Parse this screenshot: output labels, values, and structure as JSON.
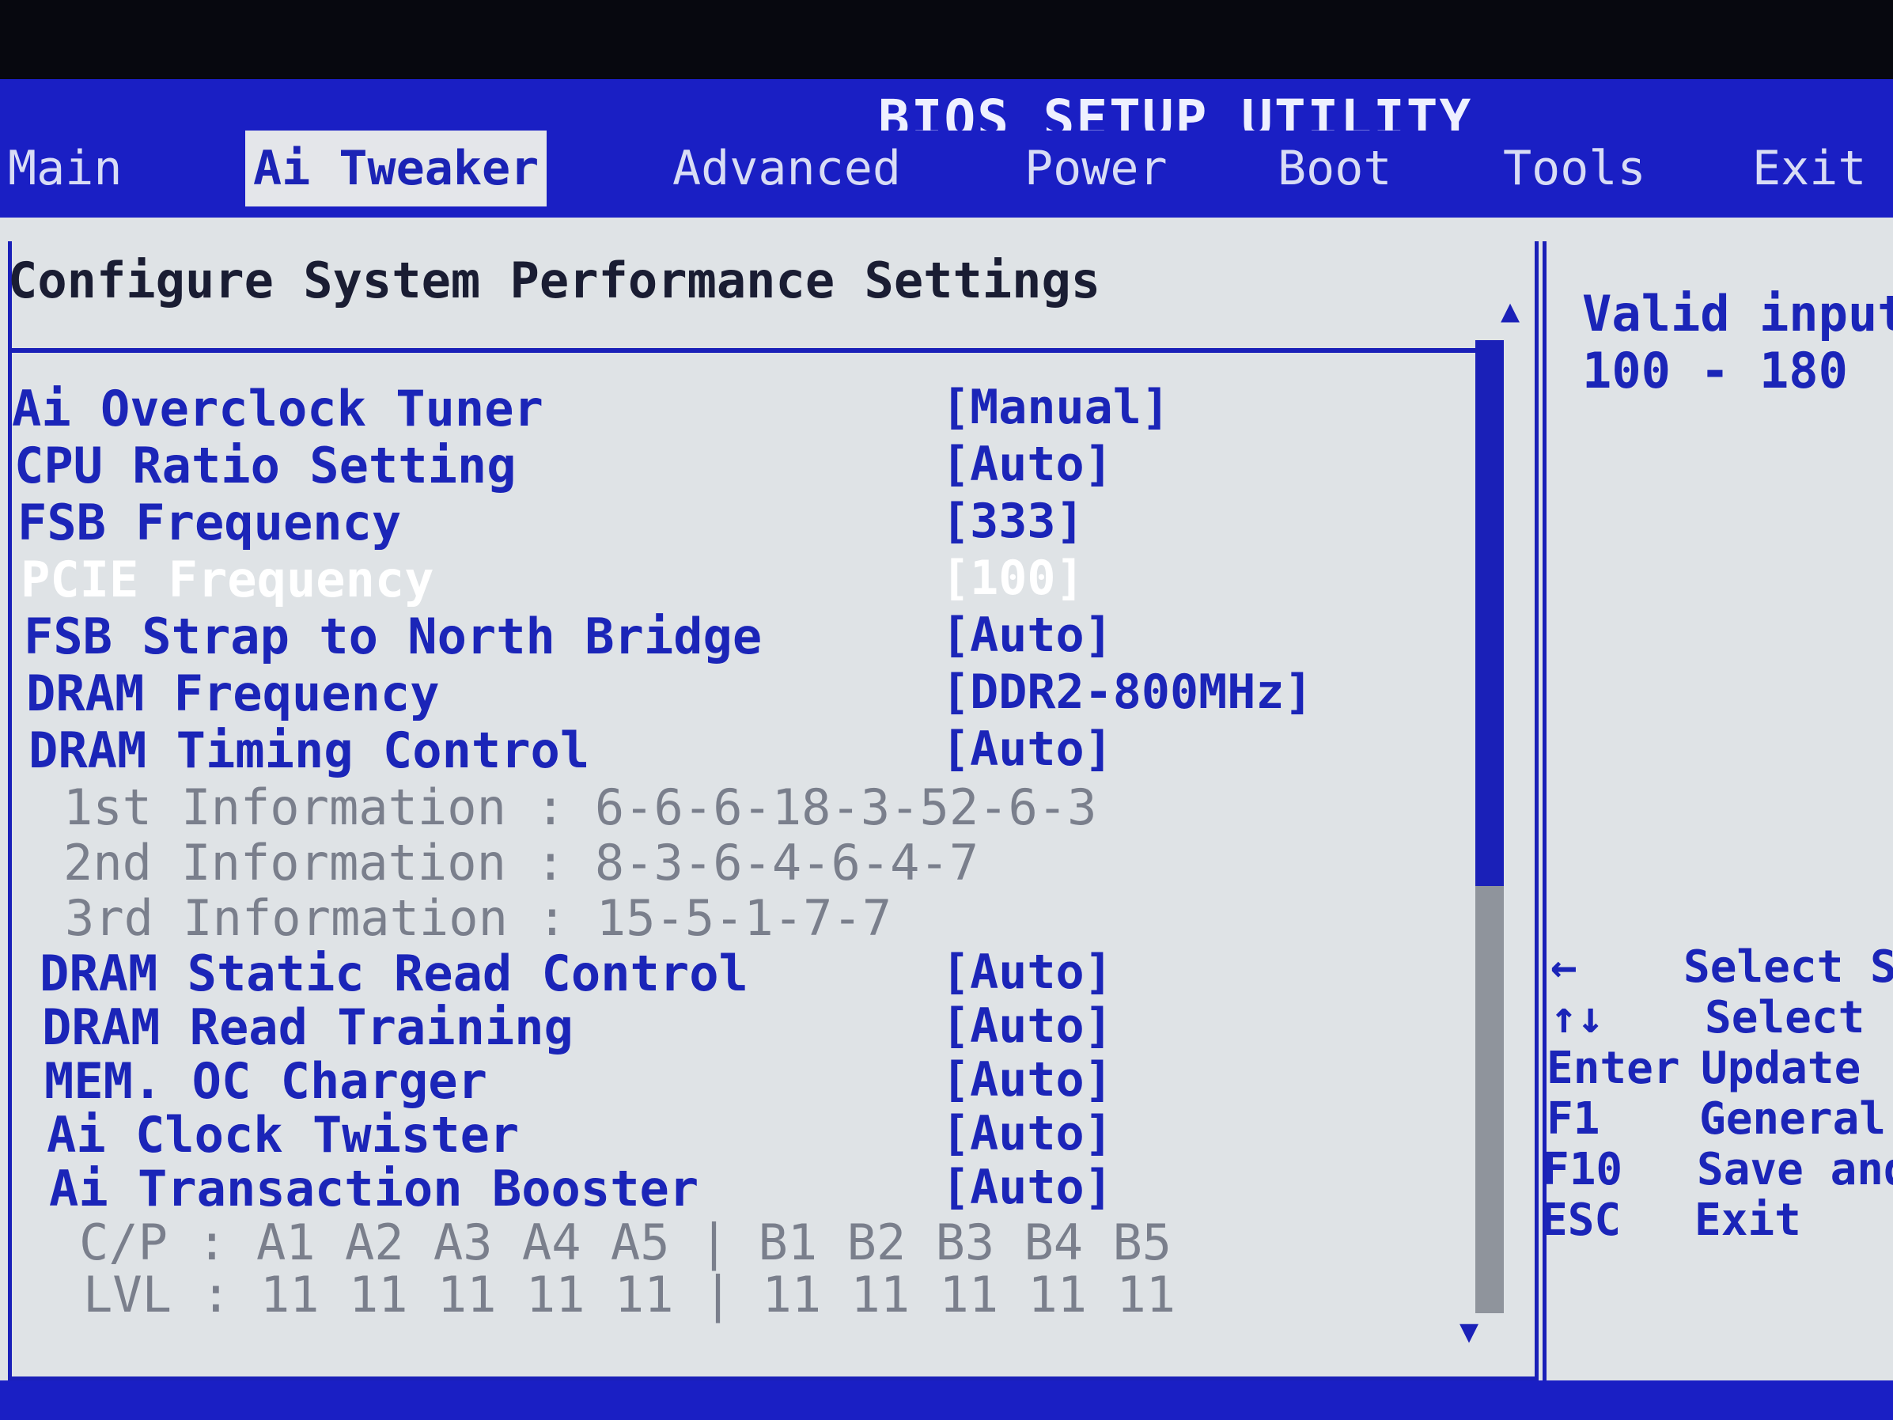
{
  "title": "BIOS SETUP UTILITY",
  "tabs": [
    {
      "label": "Main"
    },
    {
      "label": "Ai Tweaker"
    },
    {
      "label": "Advanced"
    },
    {
      "label": "Power"
    },
    {
      "label": "Boot"
    },
    {
      "label": "Tools"
    },
    {
      "label": "Exit"
    }
  ],
  "section_title": "Configure System Performance Settings",
  "settings": [
    {
      "label": "Ai Overclock Tuner",
      "value": "[Manual]"
    },
    {
      "label": "CPU Ratio Setting",
      "value": "[Auto]"
    },
    {
      "label": "FSB Frequency",
      "value": "[333]"
    },
    {
      "label": "PCIE Frequency",
      "value": "[100]"
    },
    {
      "label": "FSB Strap to North Bridge",
      "value": "[Auto]"
    },
    {
      "label": "DRAM Frequency",
      "value": "[DDR2-800MHz]"
    },
    {
      "label": "DRAM Timing Control",
      "value": "[Auto]"
    }
  ],
  "timing_info": [
    {
      "text": "1st Information : 6-6-6-18-3-52-6-3"
    },
    {
      "text": "2nd Information : 8-3-6-4-6-4-7"
    },
    {
      "text": "3rd Information : 15-5-1-7-7"
    }
  ],
  "settings2": [
    {
      "label": "DRAM Static Read Control",
      "value": "[Auto]"
    },
    {
      "label": "DRAM Read Training",
      "value": "[Auto]"
    },
    {
      "label": "MEM. OC Charger",
      "value": "[Auto]"
    },
    {
      "label": "Ai Clock Twister",
      "value": "[Auto]"
    },
    {
      "label": "Ai Transaction Booster",
      "value": "[Auto]"
    }
  ],
  "booster_info": [
    {
      "text": "C/P : A1 A2 A3 A4 A5 | B1 B2 B3 B4 B5"
    },
    {
      "text": "LVL : 11 11 11 11 11 | 11 11 11 11 11"
    }
  ],
  "help": {
    "line1": "Valid input",
    "line2": "100 - 180"
  },
  "keys": [
    {
      "key": "←",
      "desc": "Select S"
    },
    {
      "key": "↑↓",
      "desc": "Select"
    },
    {
      "key": "Enter",
      "desc": "Update"
    },
    {
      "key": "F1",
      "desc": "General"
    },
    {
      "key": "F10",
      "desc": "Save and"
    },
    {
      "key": "ESC",
      "desc": "Exit"
    }
  ]
}
